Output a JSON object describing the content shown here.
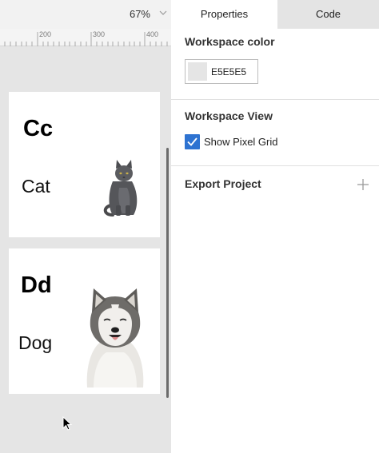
{
  "canvas": {
    "zoom": "67%",
    "ruler_labels": [
      "200",
      "300",
      "400"
    ],
    "cards": [
      {
        "letter": "Cc",
        "word": "Cat",
        "image": "cat-image"
      },
      {
        "letter": "Dd",
        "word": "Dog",
        "image": "dog-image"
      }
    ]
  },
  "panel": {
    "tabs": [
      {
        "label": "Properties",
        "active": true
      },
      {
        "label": "Code",
        "active": false
      }
    ],
    "workspace_color": {
      "title": "Workspace color",
      "hex": "E5E5E5",
      "swatch": "#E5E5E5"
    },
    "workspace_view": {
      "title": "Workspace View",
      "pixel_grid_label": "Show Pixel Grid",
      "pixel_grid_checked": true
    },
    "export": {
      "title": "Export Project",
      "icon": "plus-icon"
    }
  },
  "colors": {
    "accent": "#2E73D1",
    "canvas_bg": "#E5E5E5",
    "inactive_tab": "#E4E4E4"
  }
}
